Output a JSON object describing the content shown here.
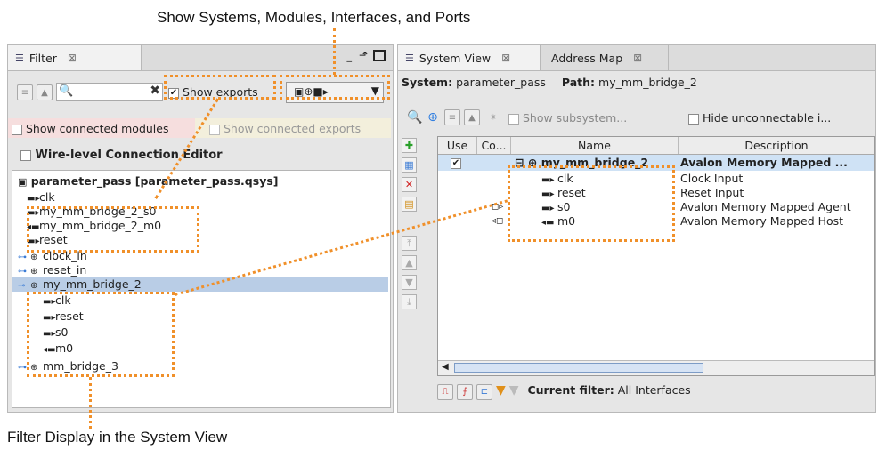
{
  "callouts": {
    "top": "Show Systems, Modules, Interfaces, and Ports",
    "bottom": "Filter Display in the System View"
  },
  "colors": {
    "highlight": "#f0902a",
    "selection": "#b9cde6",
    "sysHeader": "#cfe2f5"
  },
  "filter_panel": {
    "tab_label": "Filter",
    "tab_close": "⊠",
    "show_exports_label": "Show exports",
    "show_connected_modules_label": "Show connected modules",
    "show_connected_exports_label": "Show connected exports",
    "wire_level_label": "Wire-level Connection Editor",
    "tree": {
      "root": "parameter_pass [parameter_pass.qsys]",
      "items": [
        {
          "label": "clk",
          "kind": "port"
        },
        {
          "label": "my_mm_bridge_2_s0",
          "kind": "port"
        },
        {
          "label": "my_mm_bridge_2_m0",
          "kind": "port"
        },
        {
          "label": "reset",
          "kind": "port"
        },
        {
          "label": "clock_in",
          "kind": "module"
        },
        {
          "label": "reset_in",
          "kind": "module"
        },
        {
          "label": "my_mm_bridge_2",
          "kind": "module"
        },
        {
          "label": "clk",
          "kind": "port"
        },
        {
          "label": "reset",
          "kind": "port"
        },
        {
          "label": "s0",
          "kind": "port"
        },
        {
          "label": "m0",
          "kind": "port"
        },
        {
          "label": "mm_bridge_3",
          "kind": "module"
        }
      ]
    }
  },
  "system_panel": {
    "tabs": [
      "System View",
      "Address Map"
    ],
    "tab_close": "⊠",
    "system_label": "System:",
    "system_value": "parameter_pass",
    "path_label": "Path:",
    "path_value": "my_mm_bridge_2",
    "show_subsystem_label": "Show subsystem...",
    "hide_unconnectable_label": "Hide unconnectable i...",
    "columns": [
      "Use",
      "Co...",
      "Name",
      "Description"
    ],
    "rows": [
      {
        "name": "my_mm_bridge_2",
        "desc": "Avalon Memory Mapped ...",
        "use": "✔"
      },
      {
        "name": "clk",
        "desc": "Clock Input"
      },
      {
        "name": "reset",
        "desc": "Reset Input"
      },
      {
        "name": "s0",
        "desc": "Avalon Memory Mapped Agent"
      },
      {
        "name": "m0",
        "desc": "Avalon Memory Mapped Host"
      }
    ],
    "current_filter_label": "Current filter:",
    "current_filter_value": "All Interfaces"
  }
}
